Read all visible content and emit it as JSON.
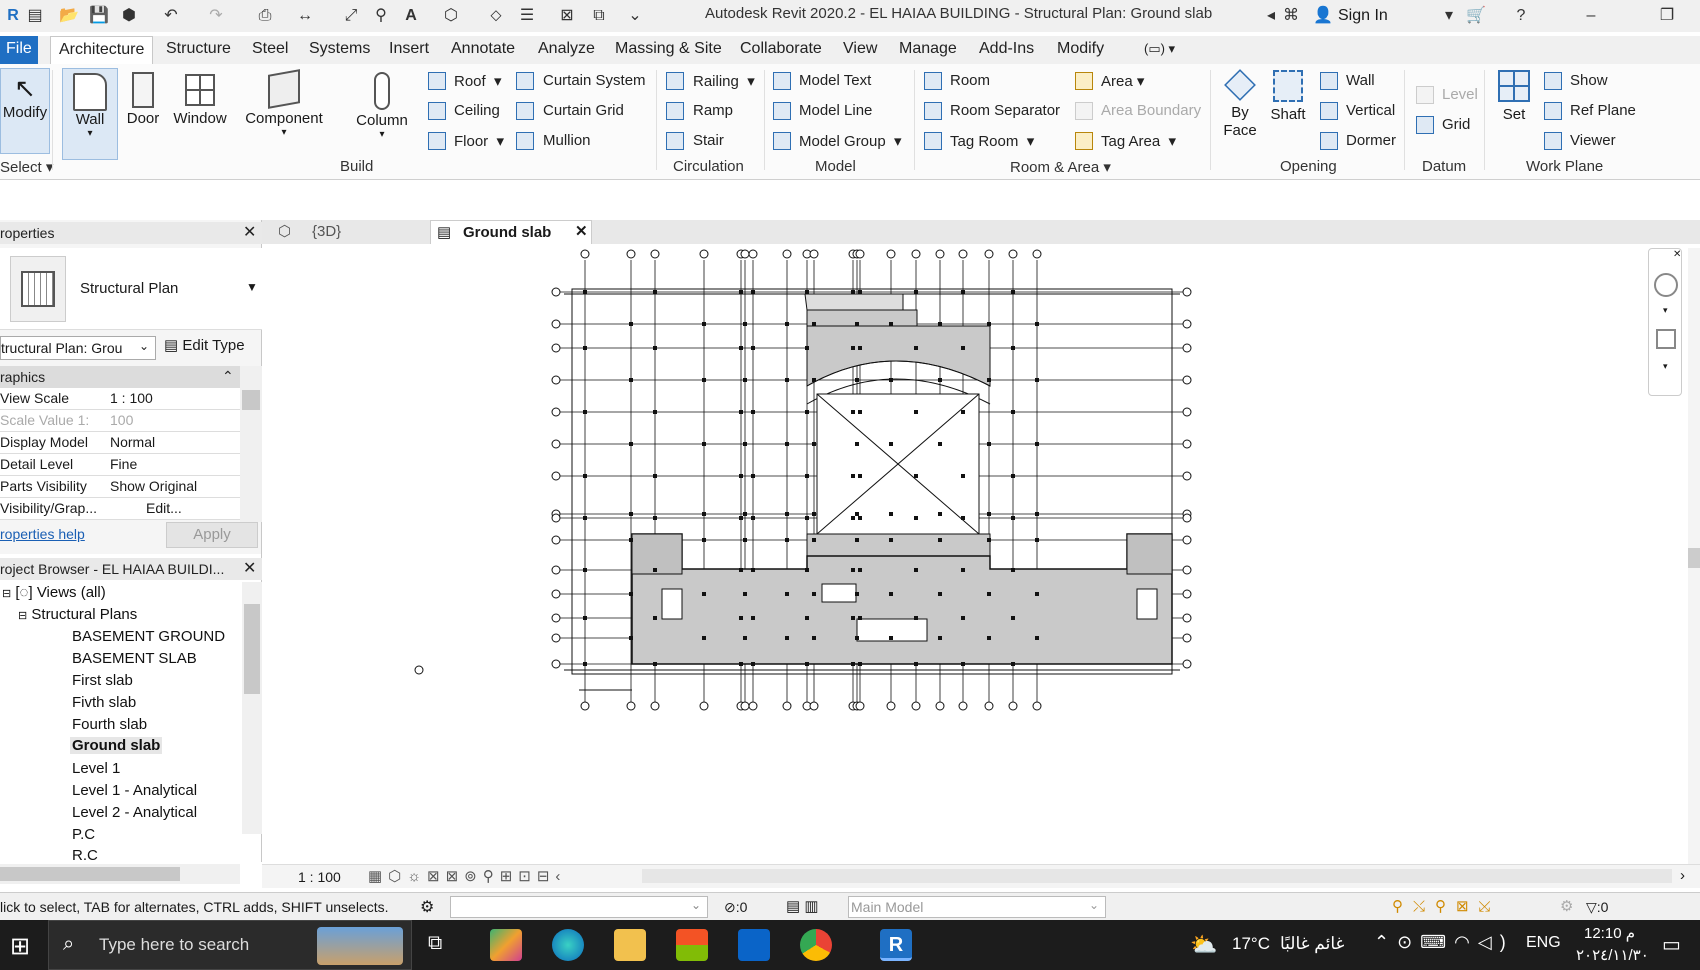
{
  "window": {
    "title": "Autodesk Revit 2020.2 - EL HAIAA BUILDING - Structural Plan: Ground slab",
    "sign_in": "Sign In"
  },
  "menu": {
    "file": "File",
    "tabs": [
      "Architecture",
      "Structure",
      "Steel",
      "Systems",
      "Insert",
      "Annotate",
      "Analyze",
      "Massing & Site",
      "Collaborate",
      "View",
      "Manage",
      "Add-Ins",
      "Modify"
    ]
  },
  "ribbon": {
    "modify": "Modify",
    "select": "Select",
    "wall": "Wall",
    "door": "Door",
    "window": "Window",
    "component": "Component",
    "column": "Column",
    "roof": "Roof",
    "ceiling": "Ceiling",
    "floor": "Floor",
    "curtain_system": "Curtain System",
    "curtain_grid": "Curtain Grid",
    "mullion": "Mullion",
    "railing": "Railing",
    "ramp": "Ramp",
    "stair": "Stair",
    "model_text": "Model Text",
    "model_line": "Model Line",
    "model_group": "Model Group",
    "room": "Room",
    "room_separator": "Room Separator",
    "tag_room": "Tag Room",
    "area": "Area",
    "area_boundary": "Area Boundary",
    "tag_area": "Tag Area",
    "by_face": "By Face",
    "shaft": "Shaft",
    "wall_opening": "Wall",
    "vertical": "Vertical",
    "dormer": "Dormer",
    "level": "Level",
    "grid": "Grid",
    "set": "Set",
    "show": "Show",
    "ref_plane": "Ref Plane",
    "viewer": "Viewer",
    "groups": {
      "build": "Build",
      "circulation": "Circulation",
      "model": "Model",
      "room_area": "Room & Area",
      "opening": "Opening",
      "datum": "Datum",
      "work_plane": "Work Plane"
    }
  },
  "properties": {
    "title": "roperties",
    "type_name": "Structural Plan",
    "instance_select": "tructural Plan: Grou",
    "edit_type": "Edit Type",
    "section": "raphics",
    "rows": [
      {
        "k": "View Scale",
        "v": "1 : 100"
      },
      {
        "k": "Scale Value   1:",
        "v": "100"
      },
      {
        "k": "Display Model",
        "v": "Normal"
      },
      {
        "k": "Detail Level",
        "v": "Fine"
      },
      {
        "k": "Parts Visibility",
        "v": "Show Original"
      },
      {
        "k": "Visibility/Grap...",
        "v": "Edit..."
      }
    ],
    "help": "roperties help",
    "apply": "Apply"
  },
  "browser": {
    "title": "roject Browser - EL HAIAA BUILDI...",
    "views_all": "Views (all)",
    "structural_plans": "Structural Plans",
    "items": [
      "BASEMENT GROUND",
      "BASEMENT SLAB",
      "First slab",
      "Fivth slab",
      "Fourth slab",
      "Ground slab",
      "Level 1",
      "Level 1 - Analytical",
      "Level 2 - Analytical",
      "P.C",
      "R.C"
    ]
  },
  "viewtabs": {
    "tab_3d": "{3D}",
    "tab_ground": "Ground slab"
  },
  "view_status": {
    "scale": "1 : 100"
  },
  "statusbar": {
    "hint": "lick to select, TAB for alternates, CTRL adds, SHIFT unselects.",
    "count": ":0",
    "model": "Main Model",
    "filter": ":0"
  },
  "taskbar": {
    "search": "Type here to search",
    "weather": "17°C",
    "weather_text": "غائم غالبًا",
    "lang": "ENG",
    "time": "12:10 م",
    "date": "٢٠٢٤/١١/٣٠"
  },
  "colors": {
    "file_tab": "#1f6fc3",
    "accent": "#2f6fb3",
    "slab_fill": "#c9c9c9",
    "taskbar": "#1c1c1c"
  }
}
